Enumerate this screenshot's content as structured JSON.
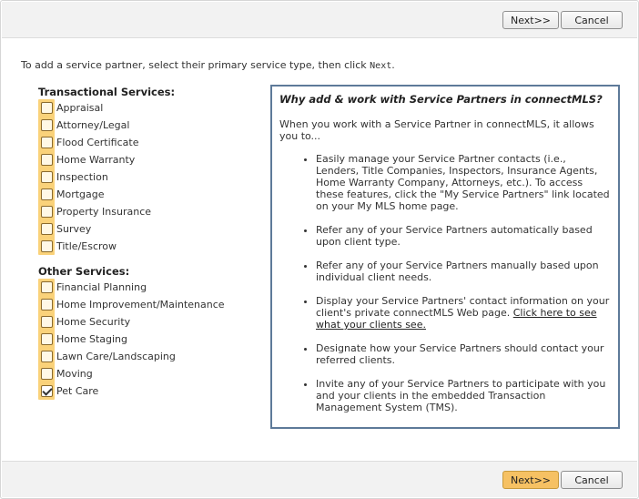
{
  "buttons": {
    "next_label": "Next>>",
    "cancel_label": "Cancel"
  },
  "intro": {
    "text": "To add a service partner, select their primary service type, then click ",
    "next_word": "Next",
    "period": "."
  },
  "transactional": {
    "heading": "Transactional Services:",
    "items": [
      {
        "label": "Appraisal",
        "checked": false
      },
      {
        "label": "Attorney/Legal",
        "checked": false
      },
      {
        "label": "Flood Certificate",
        "checked": false
      },
      {
        "label": "Home Warranty",
        "checked": false
      },
      {
        "label": "Inspection",
        "checked": false
      },
      {
        "label": "Mortgage",
        "checked": false
      },
      {
        "label": "Property Insurance",
        "checked": false
      },
      {
        "label": "Survey",
        "checked": false
      },
      {
        "label": "Title/Escrow",
        "checked": false
      }
    ]
  },
  "other": {
    "heading": "Other Services:",
    "items": [
      {
        "label": "Financial Planning",
        "checked": false
      },
      {
        "label": "Home Improvement/Maintenance",
        "checked": false
      },
      {
        "label": "Home Security",
        "checked": false
      },
      {
        "label": "Home Staging",
        "checked": false
      },
      {
        "label": "Lawn Care/Landscaping",
        "checked": false
      },
      {
        "label": "Moving",
        "checked": false
      },
      {
        "label": "Pet Care",
        "checked": true
      }
    ]
  },
  "panel": {
    "title": "Why add & work with Service Partners in connectMLS?",
    "intro": "When you work with a Service Partner in connectMLS, it allows you to...",
    "bullets": [
      "Easily manage your Service Partner contacts (i.e., Lenders, Title Companies, Inspectors, Insurance Agents, Home Warranty Company, Attorneys, etc.). To access these features, click the \"My Service Partners\" link located on your My MLS home page.",
      "Refer any of your Service Partners automatically based upon client type.",
      "Refer any of your Service Partners manually based upon individual client needs.",
      "Display your Service Partners' contact information on your client's private connectMLS Web page. ",
      "Designate how your Service Partners should contact your referred clients.",
      "Invite any of your Service Partners to participate with you and your clients in the embedded Transaction Management System (TMS)."
    ],
    "link_text": "Click here to see what your clients see."
  },
  "colors": {
    "accent": "#f6c163",
    "highlight": "#fad27a",
    "panel_border": "#5d7a99"
  }
}
